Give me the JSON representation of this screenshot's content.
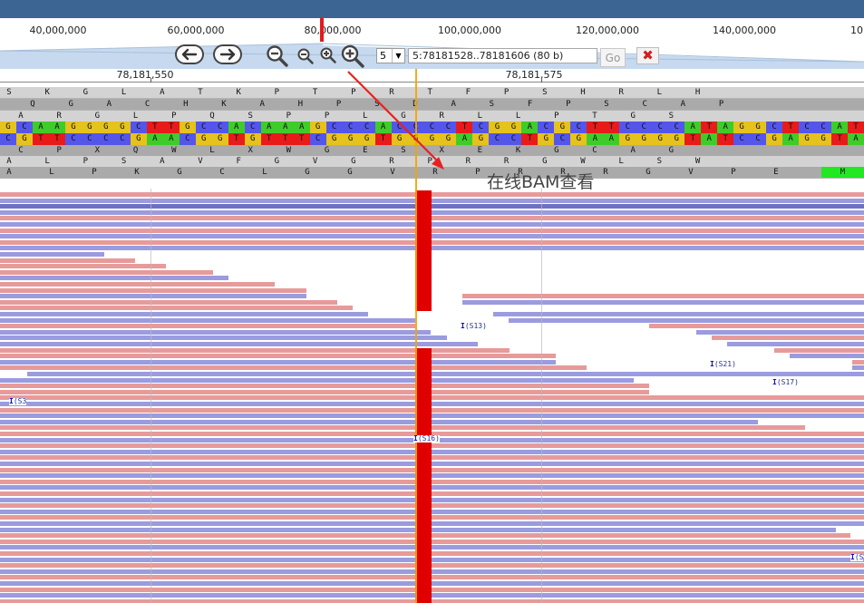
{
  "ruler": {
    "ticks": [
      "40,000,000",
      "60,000,000",
      "80,000,000",
      "100,000,000",
      "120,000,000",
      "140,000,000",
      "10"
    ]
  },
  "toolbar": {
    "zoom_level": "5",
    "locus_value": "5:78181528..78181606 (80 b)",
    "go_label": "Go",
    "close_label": "✖"
  },
  "positions": {
    "left": "78,181,550",
    "right": "78,181,575"
  },
  "annotation": {
    "text": "在线BAM查看"
  },
  "insertions": {
    "s13": "(S13)",
    "s21": "(S21)",
    "s17": "(S17)",
    "s3": "(S3",
    "s16": "(S16)",
    "s_last": "(S"
  },
  "sequence": {
    "frame_top_1": [
      "S",
      "K",
      "G",
      "L",
      "A",
      "T",
      "K",
      "P",
      "T",
      "P",
      "R",
      "T",
      "F",
      "P",
      "S",
      "H",
      "R",
      "L",
      "H"
    ],
    "frame_top_2": [
      "Q",
      "G",
      "A",
      "C",
      "H",
      "K",
      "A",
      "H",
      "P",
      "S",
      "D",
      "A",
      "S",
      "F",
      "P",
      "S",
      "C",
      "A",
      "P"
    ],
    "frame_top_3": [
      "A",
      "R",
      "G",
      "L",
      "P",
      "Q",
      "S",
      "P",
      "P",
      "L",
      "G",
      "R",
      "L",
      "L",
      "P",
      "T",
      "G",
      "S"
    ],
    "forward_strand": "GCAAGGGGCTTGCCACAAAGCCCACCCCTCGGACGCTTCCCCATAGGCTCCAT",
    "reverse_strand": "CGTTCCCCGAACGGTGTTTCGGGTGGGGAGCCTGCGAAGGGGTATCCGAGGTA",
    "frame_bot_1": [
      "C",
      "P",
      "X",
      "Q",
      "W",
      "L",
      "X",
      "W",
      "G",
      "E",
      "S",
      "X",
      "E",
      "K",
      "G",
      "C",
      "A",
      "G"
    ],
    "frame_bot_2": [
      "A",
      "L",
      "P",
      "S",
      "A",
      "V",
      "F",
      "G",
      "V",
      "G",
      "R",
      "P",
      "R",
      "R",
      "G",
      "W",
      "L",
      "S",
      "W"
    ],
    "frame_bot_3": [
      "A",
      "L",
      "P",
      "K",
      "G",
      "C",
      "L",
      "G",
      "G",
      "V",
      "R",
      "P",
      "R",
      "R",
      "R",
      "G",
      "V",
      "P",
      "E",
      "M"
    ]
  },
  "colors": {
    "A": "#3fcc2a",
    "C": "#5456ea",
    "G": "#e6c21d",
    "T": "#e81b1b",
    "forward_read": "#e79a9a",
    "reverse_read": "#9b9be0",
    "snp": "#e00000"
  }
}
